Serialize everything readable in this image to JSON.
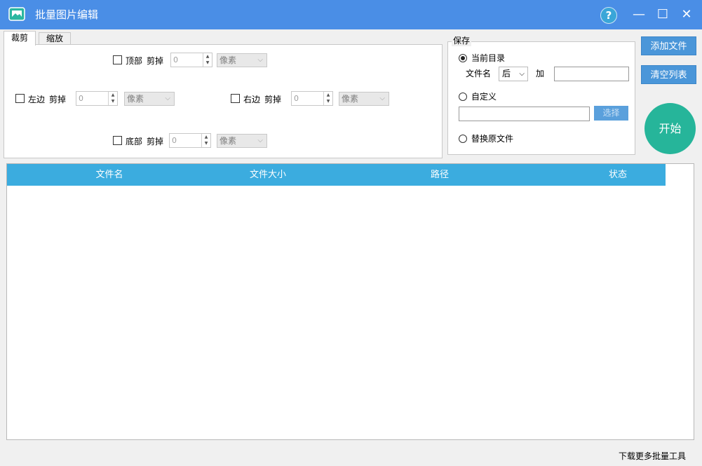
{
  "window": {
    "title": "批量图片编辑",
    "help": "?",
    "minimize": "—",
    "maximize": "☐",
    "close": "✕"
  },
  "tabs": [
    {
      "label": "裁剪",
      "active": true
    },
    {
      "label": "缩放",
      "active": false
    }
  ],
  "crop": {
    "cut_label": "剪掉",
    "top": {
      "label": "顶部",
      "value": "0",
      "unit": "像素",
      "checked": false
    },
    "left": {
      "label": "左边",
      "value": "0",
      "unit": "像素",
      "checked": false
    },
    "right": {
      "label": "右边",
      "value": "0",
      "unit": "像素",
      "checked": false
    },
    "bottom": {
      "label": "底部",
      "value": "0",
      "unit": "像素",
      "checked": false
    }
  },
  "save": {
    "legend": "保存",
    "current_dir": {
      "label": "当前目录",
      "checked": true
    },
    "filename_label": "文件名",
    "position_value": "后",
    "add_label": "加",
    "suffix_value": "",
    "custom": {
      "label": "自定义",
      "checked": false
    },
    "custom_path": "",
    "choose_button": "选择",
    "replace": {
      "label": "替换原文件",
      "checked": false
    }
  },
  "actions": {
    "add_files": "添加文件",
    "clear_list": "清空列表",
    "start": "开始"
  },
  "table": {
    "columns": [
      "文件名",
      "文件大小",
      "路径",
      "状态"
    ],
    "rows": []
  },
  "footer": {
    "link": "下载更多批量工具"
  },
  "colors": {
    "titlebar": "#4a8ee6",
    "table_header": "#3bacdf",
    "start_button": "#26b59a",
    "action_button": "#4a96d9"
  }
}
